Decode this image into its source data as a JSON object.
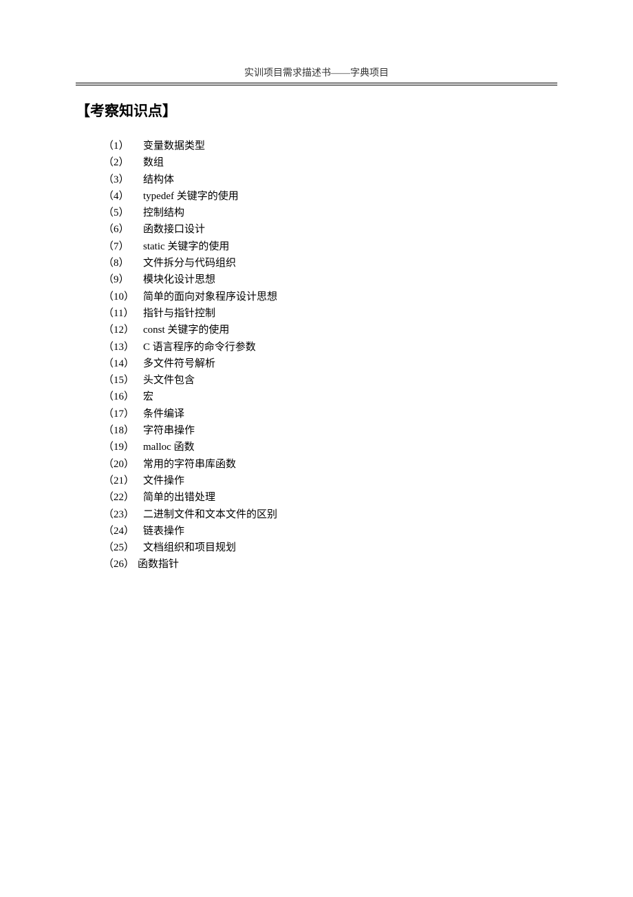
{
  "header": {
    "title": "实训项目需求描述书——字典项目"
  },
  "section": {
    "title": "【考察知识点】"
  },
  "items": [
    {
      "num": "（1）",
      "text": "变量数据类型"
    },
    {
      "num": "（2）",
      "text": "数组"
    },
    {
      "num": "（3）",
      "text": "结构体"
    },
    {
      "num": "（4）",
      "text": "typedef 关键字的使用"
    },
    {
      "num": "（5）",
      "text": "控制结构"
    },
    {
      "num": "（6）",
      "text": "函数接口设计"
    },
    {
      "num": "（7）",
      "text": "static 关键字的使用"
    },
    {
      "num": "（8）",
      "text": "文件拆分与代码组织"
    },
    {
      "num": "（9）",
      "text": "模块化设计思想"
    },
    {
      "num": "（10）",
      "text": "简单的面向对象程序设计思想"
    },
    {
      "num": "（11）",
      "text": "指针与指针控制"
    },
    {
      "num": "（12）",
      "text": "const 关键字的使用"
    },
    {
      "num": "（13）",
      "text": "C 语言程序的命令行参数"
    },
    {
      "num": "（14）",
      "text": "多文件符号解析"
    },
    {
      "num": "（15）",
      "text": "头文件包含"
    },
    {
      "num": "（16）",
      "text": "宏"
    },
    {
      "num": "（17）",
      "text": "条件编译"
    },
    {
      "num": "（18）",
      "text": "字符串操作"
    },
    {
      "num": "（19）",
      "text": "malloc 函数"
    },
    {
      "num": "（20）",
      "text": "常用的字符串库函数"
    },
    {
      "num": "（21）",
      "text": "文件操作"
    },
    {
      "num": "（22）",
      "text": "简单的出错处理"
    },
    {
      "num": "（23）",
      "text": "二进制文件和文本文件的区别"
    },
    {
      "num": "（24）",
      "text": "链表操作"
    },
    {
      "num": "（25）",
      "text": "文档组织和项目规划"
    },
    {
      "num": "（26）",
      "text": "函数指针"
    }
  ]
}
